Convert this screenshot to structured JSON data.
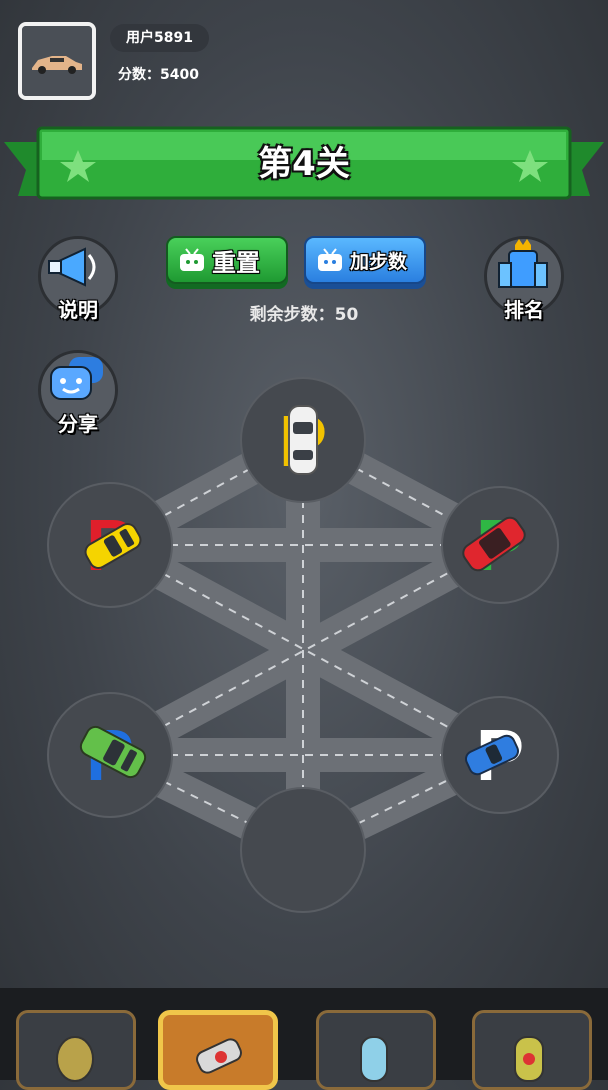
{
  "profile": {
    "username": "用户5891",
    "score_text": "分数：5400"
  },
  "level": {
    "title": "第4关"
  },
  "buttons": {
    "reset_label": "重置",
    "add_steps_label": "加步数",
    "instructions_label": "说明",
    "ranking_label": "排名",
    "share_label": "分享"
  },
  "steps_text": "剩余步数：50",
  "colors": {
    "banner_green": "#3cc24a",
    "reset_green": "#2bb13e",
    "add_steps_blue": "#3d95f0",
    "board_bg": "#4a4f56",
    "parking_red": "#e01f2b",
    "parking_green": "#2fb744",
    "parking_blue": "#1f6fe0",
    "parking_yellow": "#f2c200"
  },
  "board": {
    "cars": [
      {
        "name": "white-car",
        "color": "#f1f1f1",
        "spot": "top",
        "parking_color": "#f2c200"
      },
      {
        "name": "yellow-car",
        "color": "#f5d400",
        "spot": "left-middle",
        "parking_color": "#e01f2b"
      },
      {
        "name": "red-car",
        "color": "#e0262e",
        "spot": "right-middle",
        "parking_color": "#2fb744"
      },
      {
        "name": "green-car",
        "color": "#63c04a",
        "spot": "left-bottom",
        "parking_color": "#1f6fe0"
      },
      {
        "name": "blue-car",
        "color": "#2f7de0",
        "spot": "right-bottom",
        "parking_color": "#ffffff"
      }
    ],
    "empty_spots": [
      "bottom"
    ]
  },
  "bottom_slots": [
    {
      "icon": "egg-item-icon",
      "active": false
    },
    {
      "icon": "rocket-item-icon",
      "active": true
    },
    {
      "icon": "capsule-item-icon",
      "active": false
    },
    {
      "icon": "bomb-item-icon",
      "active": false
    }
  ]
}
